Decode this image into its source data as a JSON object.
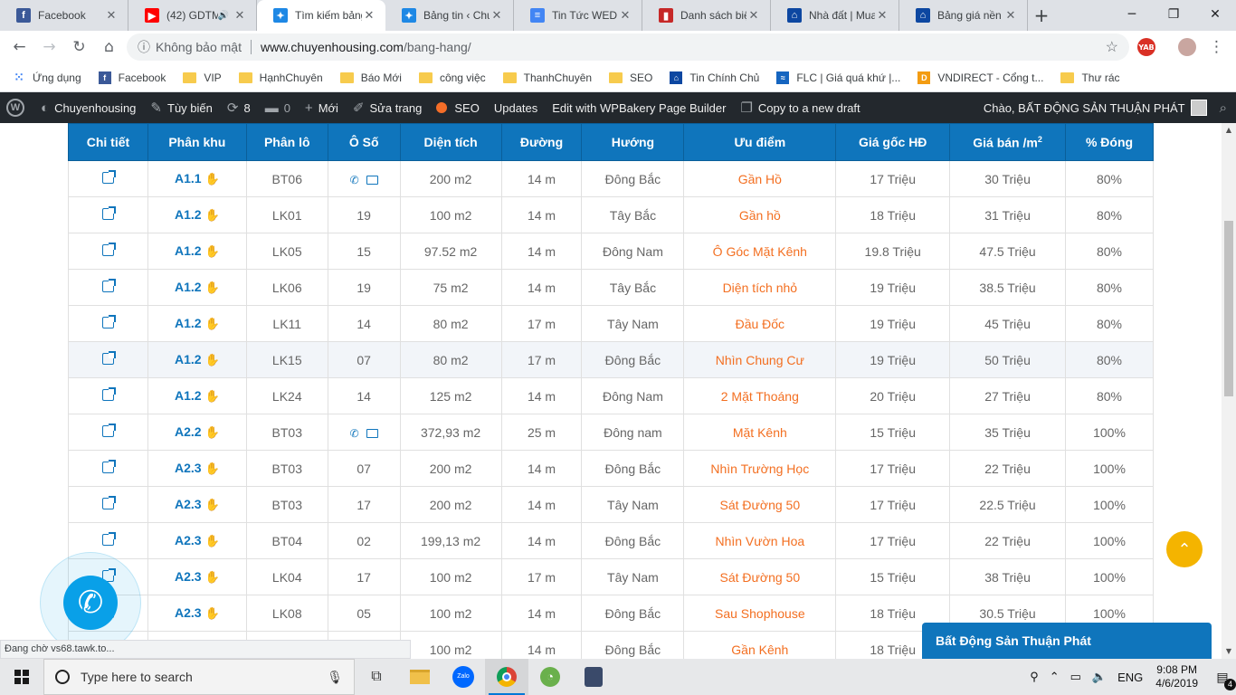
{
  "browser": {
    "tabs": [
      {
        "title": "Facebook",
        "icon_color": "#3b5998",
        "glyph": "f",
        "active": false
      },
      {
        "title": "(42) GDTM",
        "icon_color": "#ff0000",
        "glyph": "▶",
        "active": false,
        "audio": true
      },
      {
        "title": "Tìm kiếm bảng",
        "icon_color": "#1e88e5",
        "glyph": "✦",
        "active": true
      },
      {
        "title": "Bảng tin ‹ Chu",
        "icon_color": "#1e88e5",
        "glyph": "✦",
        "active": false
      },
      {
        "title": "Tin Tức WED -",
        "icon_color": "#4285f4",
        "glyph": "≡",
        "active": false
      },
      {
        "title": "Danh sách biệ",
        "icon_color": "#c62828",
        "glyph": "▮",
        "active": false
      },
      {
        "title": "Nhà đất | Mua",
        "icon_color": "#0d47a1",
        "glyph": "⌂",
        "active": false
      },
      {
        "title": "Bảng giá nền L",
        "icon_color": "#0d47a1",
        "glyph": "⌂",
        "active": false
      }
    ],
    "close_glyph": "✕",
    "new_tab_glyph": "+",
    "security_label": "Không bảo mật",
    "url_host": "www.chuyenhousing.com",
    "url_path": "/bang-hang/",
    "extension_badge": "YAB"
  },
  "bookmarks": [
    {
      "label": "Ứng dụng",
      "type": "apps"
    },
    {
      "label": "Facebook",
      "type": "fb"
    },
    {
      "label": "VIP",
      "type": "folder"
    },
    {
      "label": "HạnhChuyên",
      "type": "folder"
    },
    {
      "label": "Báo Mới",
      "type": "folder"
    },
    {
      "label": "công việc",
      "type": "folder"
    },
    {
      "label": "ThanhChuyên",
      "type": "folder"
    },
    {
      "label": "SEO",
      "type": "folder"
    },
    {
      "label": "Tin Chính Chủ",
      "type": "home"
    },
    {
      "label": "FLC | Giá quá khứ |...",
      "type": "chart"
    },
    {
      "label": "VNDIRECT - Cổng t...",
      "type": "d"
    },
    {
      "label": "Thư rác",
      "type": "folder"
    }
  ],
  "wp_admin": {
    "site_name": "Chuyenhousing",
    "customize": "Tùy biến",
    "updates_count": "8",
    "comments_count": "0",
    "new": "Mới",
    "edit_page": "Sửa trang",
    "seo": "SEO",
    "updates": "Updates",
    "wpbakery": "Edit with WPBakery Page Builder",
    "copy_draft": "Copy to a new draft",
    "greeting": "Chào, BẤT ĐỘNG SẢN THUẬN PHÁT"
  },
  "table": {
    "headers": [
      "Chi tiết",
      "Phân khu",
      "Phân lô",
      "Ô Số",
      "Diện tích",
      "Đường",
      "Hướng",
      "Ưu điểm",
      "Giá gốc HĐ",
      "Giá bán /m",
      "% Đóng"
    ],
    "header_sup": "2",
    "rows": [
      {
        "zone": "A1.1",
        "lot": "BT06",
        "num": "",
        "contact": true,
        "area": "200 m2",
        "road": "14 m",
        "dir": "Đông Bắc",
        "adv": "Gần Hồ",
        "base": "17 Triệu",
        "price": "30 Triệu",
        "paid": "80%"
      },
      {
        "zone": "A1.2",
        "lot": "LK01",
        "num": "19",
        "area": "100 m2",
        "road": "14 m",
        "dir": "Tây Bắc",
        "adv": "Gần hồ",
        "base": "18 Triệu",
        "price": "31 Triệu",
        "paid": "80%"
      },
      {
        "zone": "A1.2",
        "lot": "LK05",
        "num": "15",
        "area": "97.52 m2",
        "road": "14 m",
        "dir": "Đông Nam",
        "adv": "Ô Góc Mặt Kênh",
        "base": "19.8 Triệu",
        "price": "47.5 Triệu",
        "paid": "80%"
      },
      {
        "zone": "A1.2",
        "lot": "LK06",
        "num": "19",
        "area": "75 m2",
        "road": "14 m",
        "dir": "Tây Bắc",
        "adv": "Diện tích nhỏ",
        "base": "19 Triệu",
        "price": "38.5 Triệu",
        "paid": "80%"
      },
      {
        "zone": "A1.2",
        "lot": "LK11",
        "num": "14",
        "area": "80 m2",
        "road": "17 m",
        "dir": "Tây Nam",
        "adv": "Đầu Đốc",
        "base": "19 Triệu",
        "price": "45 Triệu",
        "paid": "80%"
      },
      {
        "zone": "A1.2",
        "lot": "LK15",
        "num": "07",
        "area": "80 m2",
        "road": "17 m",
        "dir": "Đông Bắc",
        "adv": "Nhìn Chung Cư",
        "base": "19 Triệu",
        "price": "50 Triệu",
        "paid": "80%",
        "hl": true
      },
      {
        "zone": "A1.2",
        "lot": "LK24",
        "num": "14",
        "area": "125 m2",
        "road": "14 m",
        "dir": "Đông Nam",
        "adv": "2 Mặt Thoáng",
        "base": "20 Triệu",
        "price": "27 Triệu",
        "paid": "80%"
      },
      {
        "zone": "A2.2",
        "lot": "BT03",
        "num": "",
        "contact": true,
        "area": "372,93 m2",
        "road": "25 m",
        "dir": "Đông nam",
        "adv": "Mặt Kênh",
        "base": "15 Triệu",
        "price": "35 Triệu",
        "paid": "100%"
      },
      {
        "zone": "A2.3",
        "lot": "BT03",
        "num": "07",
        "area": "200 m2",
        "road": "14 m",
        "dir": "Đông Bắc",
        "adv": "Nhìn Trường Học",
        "base": "17 Triệu",
        "price": "22 Triệu",
        "paid": "100%"
      },
      {
        "zone": "A2.3",
        "lot": "BT03",
        "num": "17",
        "area": "200 m2",
        "road": "14 m",
        "dir": "Tây Nam",
        "adv": "Sát Đường 50",
        "base": "17 Triệu",
        "price": "22.5 Triệu",
        "paid": "100%"
      },
      {
        "zone": "A2.3",
        "lot": "BT04",
        "num": "02",
        "area": "199,13 m2",
        "road": "14 m",
        "dir": "Đông Bắc",
        "adv": "Nhìn Vườn Hoa",
        "base": "17 Triệu",
        "price": "22 Triệu",
        "paid": "100%"
      },
      {
        "zone": "A2.3",
        "lot": "LK04",
        "num": "17",
        "area": "100 m2",
        "road": "17 m",
        "dir": "Tây Nam",
        "adv": "Sát Đường 50",
        "base": "15 Triệu",
        "price": "38 Triệu",
        "paid": "100%"
      },
      {
        "zone": "A2.3",
        "lot": "LK08",
        "num": "05",
        "area": "100 m2",
        "road": "14 m",
        "dir": "Đông Bắc",
        "adv": "Sau Shophouse",
        "base": "18 Triệu",
        "price": "30.5 Triệu",
        "paid": "100%"
      },
      {
        "zone": "",
        "lot": "",
        "num": "",
        "area": "100 m2",
        "road": "14 m",
        "dir": "Đông Bắc",
        "adv": "Gần Kênh",
        "base": "18 Triệu",
        "price": "",
        "paid": ""
      }
    ]
  },
  "chat_widget_title": "Bất Động Sản Thuận Phát",
  "status_text": "Đang chờ vs68.tawk.to...",
  "taskbar": {
    "search_placeholder": "Type here to search",
    "language": "ENG",
    "time": "9:08 PM",
    "date": "4/6/2019",
    "notification_count": "4",
    "zalo_label": "Zalo"
  }
}
